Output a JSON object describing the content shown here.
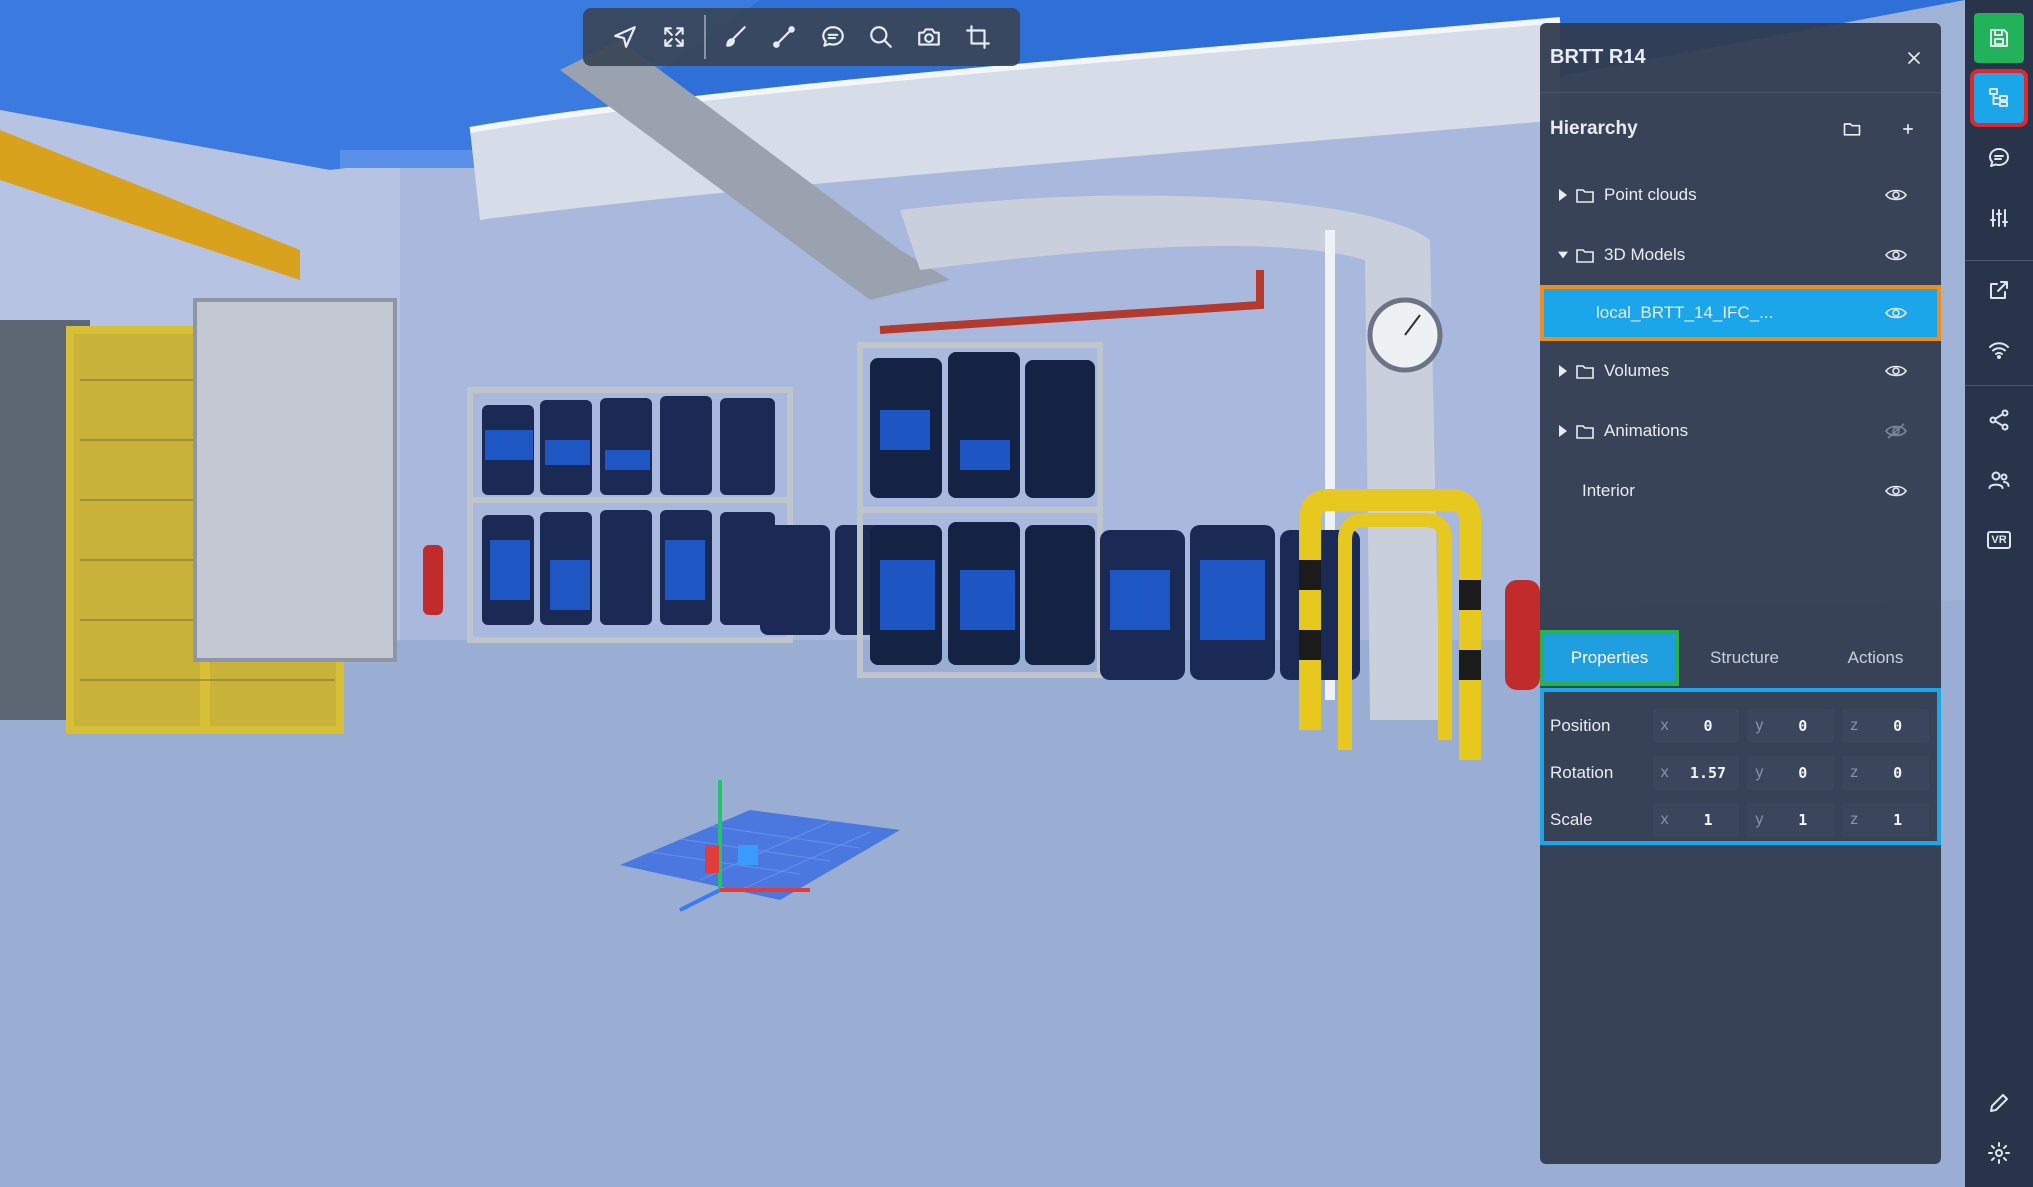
{
  "toolbar": {
    "tools": [
      {
        "name": "navigate-icon"
      },
      {
        "name": "fit-view-icon"
      },
      {
        "name": "paint-brush-icon"
      },
      {
        "name": "measure-icon"
      },
      {
        "name": "comment-icon"
      },
      {
        "name": "search-icon"
      },
      {
        "name": "camera-icon"
      },
      {
        "name": "crop-icon"
      }
    ]
  },
  "panel": {
    "title": "BRTT R14",
    "hierarchy": {
      "title": "Hierarchy",
      "items": [
        {
          "label": "Point clouds",
          "expanded": false,
          "visible": true
        },
        {
          "label": "3D Models",
          "expanded": true,
          "visible": true
        },
        {
          "label": "local_BRTT_14_IFC_...",
          "selected": true,
          "visible": true
        },
        {
          "label": "Volumes",
          "expanded": false,
          "visible": true
        },
        {
          "label": "Animations",
          "expanded": false,
          "visible": false
        },
        {
          "label": "Interior",
          "visible": true
        }
      ]
    },
    "tabs": [
      "Properties",
      "Structure",
      "Actions"
    ],
    "active_tab": "Properties",
    "properties": {
      "position": {
        "label": "Position",
        "x": "0",
        "y": "0",
        "z": "0"
      },
      "rotation": {
        "label": "Rotation",
        "x": "1.57",
        "y": "0",
        "z": "0"
      },
      "scale": {
        "label": "Scale",
        "x": "1",
        "y": "1",
        "z": "1"
      },
      "axis_labels": {
        "x": "x",
        "y": "y",
        "z": "z"
      }
    }
  },
  "rail": {
    "vr_label": "VR",
    "highlight_colors": {
      "save": "#22b35a",
      "hierarchy": "#1aa6e8",
      "hierarchy_outline": "#e0262f"
    }
  },
  "colors": {
    "selection": "#1aa6e8",
    "selection_outline": "#f08c1e",
    "active_tab_outline": "#28b34a"
  }
}
